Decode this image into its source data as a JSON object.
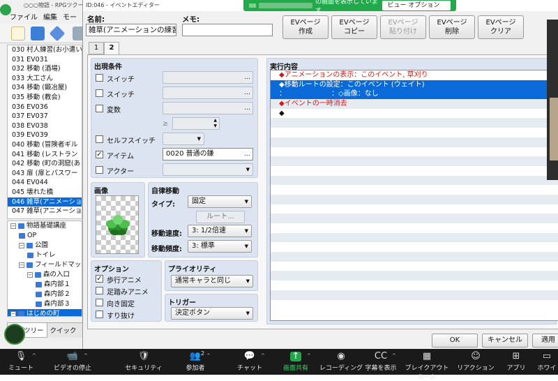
{
  "back_app": {
    "title": "○○○物語 - RPGツクール",
    "menu": [
      "ファイル",
      "編集",
      "モー"
    ],
    "map_events": [
      "030 村人練習(お小遣い",
      "031 EV031",
      "032 移動 (酒場)",
      "033 大工さん",
      "034 移動 (鍛冶屋)",
      "035 移動 (教会)",
      "036 EV036",
      "037 EV037",
      "038 EV038",
      "039 EV039",
      "040 移動 (冒険者ギル",
      "041 移動 (レストラン",
      "042 移動 (町の洞窟(あ",
      "043 扉 (扉とパスワー",
      "044 EV044",
      "045 壊れた橋",
      "046 雑草(アニメーショ",
      "047 雑草(アニメーショ"
    ],
    "selected_event_index": 16,
    "map_tree": [
      {
        "label": "物語基礎講座",
        "indent": 0,
        "toggle": "⊟"
      },
      {
        "label": "OP",
        "indent": 1,
        "toggle": ""
      },
      {
        "label": "公園",
        "indent": 1,
        "toggle": "⊟"
      },
      {
        "label": "トイレ",
        "indent": 2,
        "toggle": ""
      },
      {
        "label": "フィールドマップ",
        "indent": 1,
        "toggle": "⊟"
      },
      {
        "label": "森の入口",
        "indent": 2,
        "toggle": "⊟"
      },
      {
        "label": "森内部１",
        "indent": 3,
        "toggle": ""
      },
      {
        "label": "森内部２",
        "indent": 3,
        "toggle": ""
      },
      {
        "label": "森内部３",
        "indent": 3,
        "toggle": ""
      },
      {
        "label": "はじめの町",
        "indent": 0,
        "toggle": "⊟"
      }
    ],
    "selected_tree_index": 9,
    "bottom_tabs": [
      "ップツリー",
      "クイック"
    ]
  },
  "dialog": {
    "title": "ID:046 - イベントエディター",
    "share_banner": {
      "text": "の画面を表示しています",
      "view_options": "ビュー オプション ⌄"
    },
    "name_label": "名前:",
    "name_value": "雑草(アニメーションの練習)",
    "memo_label": "メモ:",
    "memo_value": "",
    "page_buttons": [
      {
        "label": "EVページ\n作成",
        "enabled": true
      },
      {
        "label": "EVページ\nコピー",
        "enabled": true
      },
      {
        "label": "EVページ\n貼り付け",
        "enabled": false
      },
      {
        "label": "EVページ\n削除",
        "enabled": true
      },
      {
        "label": "EVページ\nクリア",
        "enabled": true
      }
    ],
    "tabs": [
      "1",
      "2"
    ],
    "active_tab": 1,
    "conditions": {
      "title": "出現条件",
      "switch1": {
        "label": "スイッチ",
        "checked": false,
        "value": "..."
      },
      "switch2": {
        "label": "スイッチ",
        "checked": false,
        "value": "..."
      },
      "variable": {
        "label": "変数",
        "checked": false,
        "value": "..."
      },
      "ge_symbol": "≥",
      "self_switch": {
        "label": "セルフスイッチ",
        "checked": false
      },
      "item": {
        "label": "アイテム",
        "checked": true,
        "value": "0020 普通の鎌",
        "ell": "..."
      },
      "actor": {
        "label": "アクター",
        "checked": false
      }
    },
    "image": {
      "title": "画像"
    },
    "autonomous": {
      "title": "自律移動",
      "type_label": "タイプ:",
      "type_value": "固定",
      "route_button": "ルート...",
      "speed_label": "移動速度:",
      "speed_value": "3: 1/2倍速",
      "freq_label": "移動頻度:",
      "freq_value": "3: 標準"
    },
    "options": {
      "title": "オプション",
      "items": [
        {
          "label": "歩行アニメ",
          "checked": true
        },
        {
          "label": "足踏みアニメ",
          "checked": false
        },
        {
          "label": "向き固定",
          "checked": false
        },
        {
          "label": "すり抜け",
          "checked": false
        }
      ]
    },
    "priority": {
      "title": "プライオリティ",
      "value": "通常キャラと同じ"
    },
    "trigger": {
      "title": "トリガー",
      "value": "決定ボタン"
    },
    "exec": {
      "title": "実行内容",
      "lines": [
        {
          "text": "◆アニメーションの表示：このイベント, 草刈り",
          "style": "red"
        },
        {
          "text": "◆移動ルートの設定：このイベント (ウェイト)",
          "style": "sel"
        },
        {
          "text": "：　　　　　　　：◇画像：なし",
          "style": "sel"
        },
        {
          "text": "◆イベントの一時消去",
          "style": "red"
        },
        {
          "text": "◆",
          "style": "normal"
        }
      ],
      "empty_rows": 20
    },
    "ok_button": "OK",
    "cancel_button": "キャンセル",
    "apply_button": "適用"
  },
  "zoom_bar": {
    "items": [
      {
        "name": "mute",
        "label": "ミュート",
        "icon": "🎙",
        "caret": true
      },
      {
        "name": "video",
        "label": "ビデオの停止",
        "icon": "📹",
        "caret": true
      },
      {
        "name": "security",
        "label": "セキュリティ",
        "icon": "🛡",
        "caret": false
      },
      {
        "name": "participants",
        "label": "参加者",
        "icon": "👥",
        "caret": true,
        "badge": "2"
      },
      {
        "name": "chat",
        "label": "チャット",
        "icon": "💬",
        "caret": true
      },
      {
        "name": "share",
        "label": "画面共有",
        "icon": "↑",
        "caret": true
      },
      {
        "name": "record",
        "label": "レコーディング",
        "icon": "◉",
        "caret": false
      },
      {
        "name": "cc",
        "label": "字幕を表示",
        "icon": "CC",
        "caret": true
      },
      {
        "name": "breakout",
        "label": "ブレイクアウト ルーム",
        "icon": "▦",
        "caret": false
      },
      {
        "name": "reaction",
        "label": "リアクション",
        "icon": "☺",
        "caret": false
      },
      {
        "name": "apps",
        "label": "アプリ",
        "icon": "⊞",
        "caret": false
      },
      {
        "name": "whiteboard",
        "label": "ホワイ",
        "icon": "▭",
        "caret": false
      }
    ]
  },
  "colors": {
    "accent": "#0a6ad8",
    "zoom_share": "#23a54a",
    "exec_red": "#d01818",
    "group_bg": "#dbe4f0"
  }
}
